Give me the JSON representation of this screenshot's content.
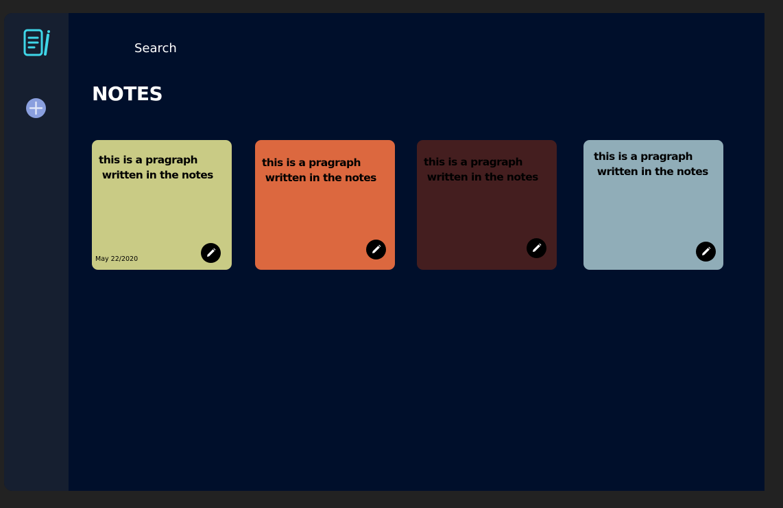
{
  "sidebar": {
    "logo_icon": "notes-logo-icon",
    "add_button_icon": "plus-icon",
    "colors": {
      "background": "#161f30",
      "logo": "#3fd6e8",
      "add_button": "#8a9fde"
    }
  },
  "search": {
    "placeholder": "Search"
  },
  "main": {
    "title": "NOTES",
    "background": "#000f2b"
  },
  "notes": [
    {
      "text": "this is a pragraph\n written in the notes",
      "date": "May 22/2020",
      "color": "#c9cb85",
      "edit_icon": "pencil-icon"
    },
    {
      "text": "this is a pragraph\n written in the notes",
      "date": "",
      "color": "#dc683f",
      "edit_icon": "pencil-icon"
    },
    {
      "text": "this is a pragraph\n written in the notes",
      "date": "",
      "color": "#441e1f",
      "edit_icon": "pencil-icon"
    },
    {
      "text": "this is a pragraph\n written in the notes",
      "date": "",
      "color": "#90adb8",
      "edit_icon": "pencil-icon"
    }
  ]
}
